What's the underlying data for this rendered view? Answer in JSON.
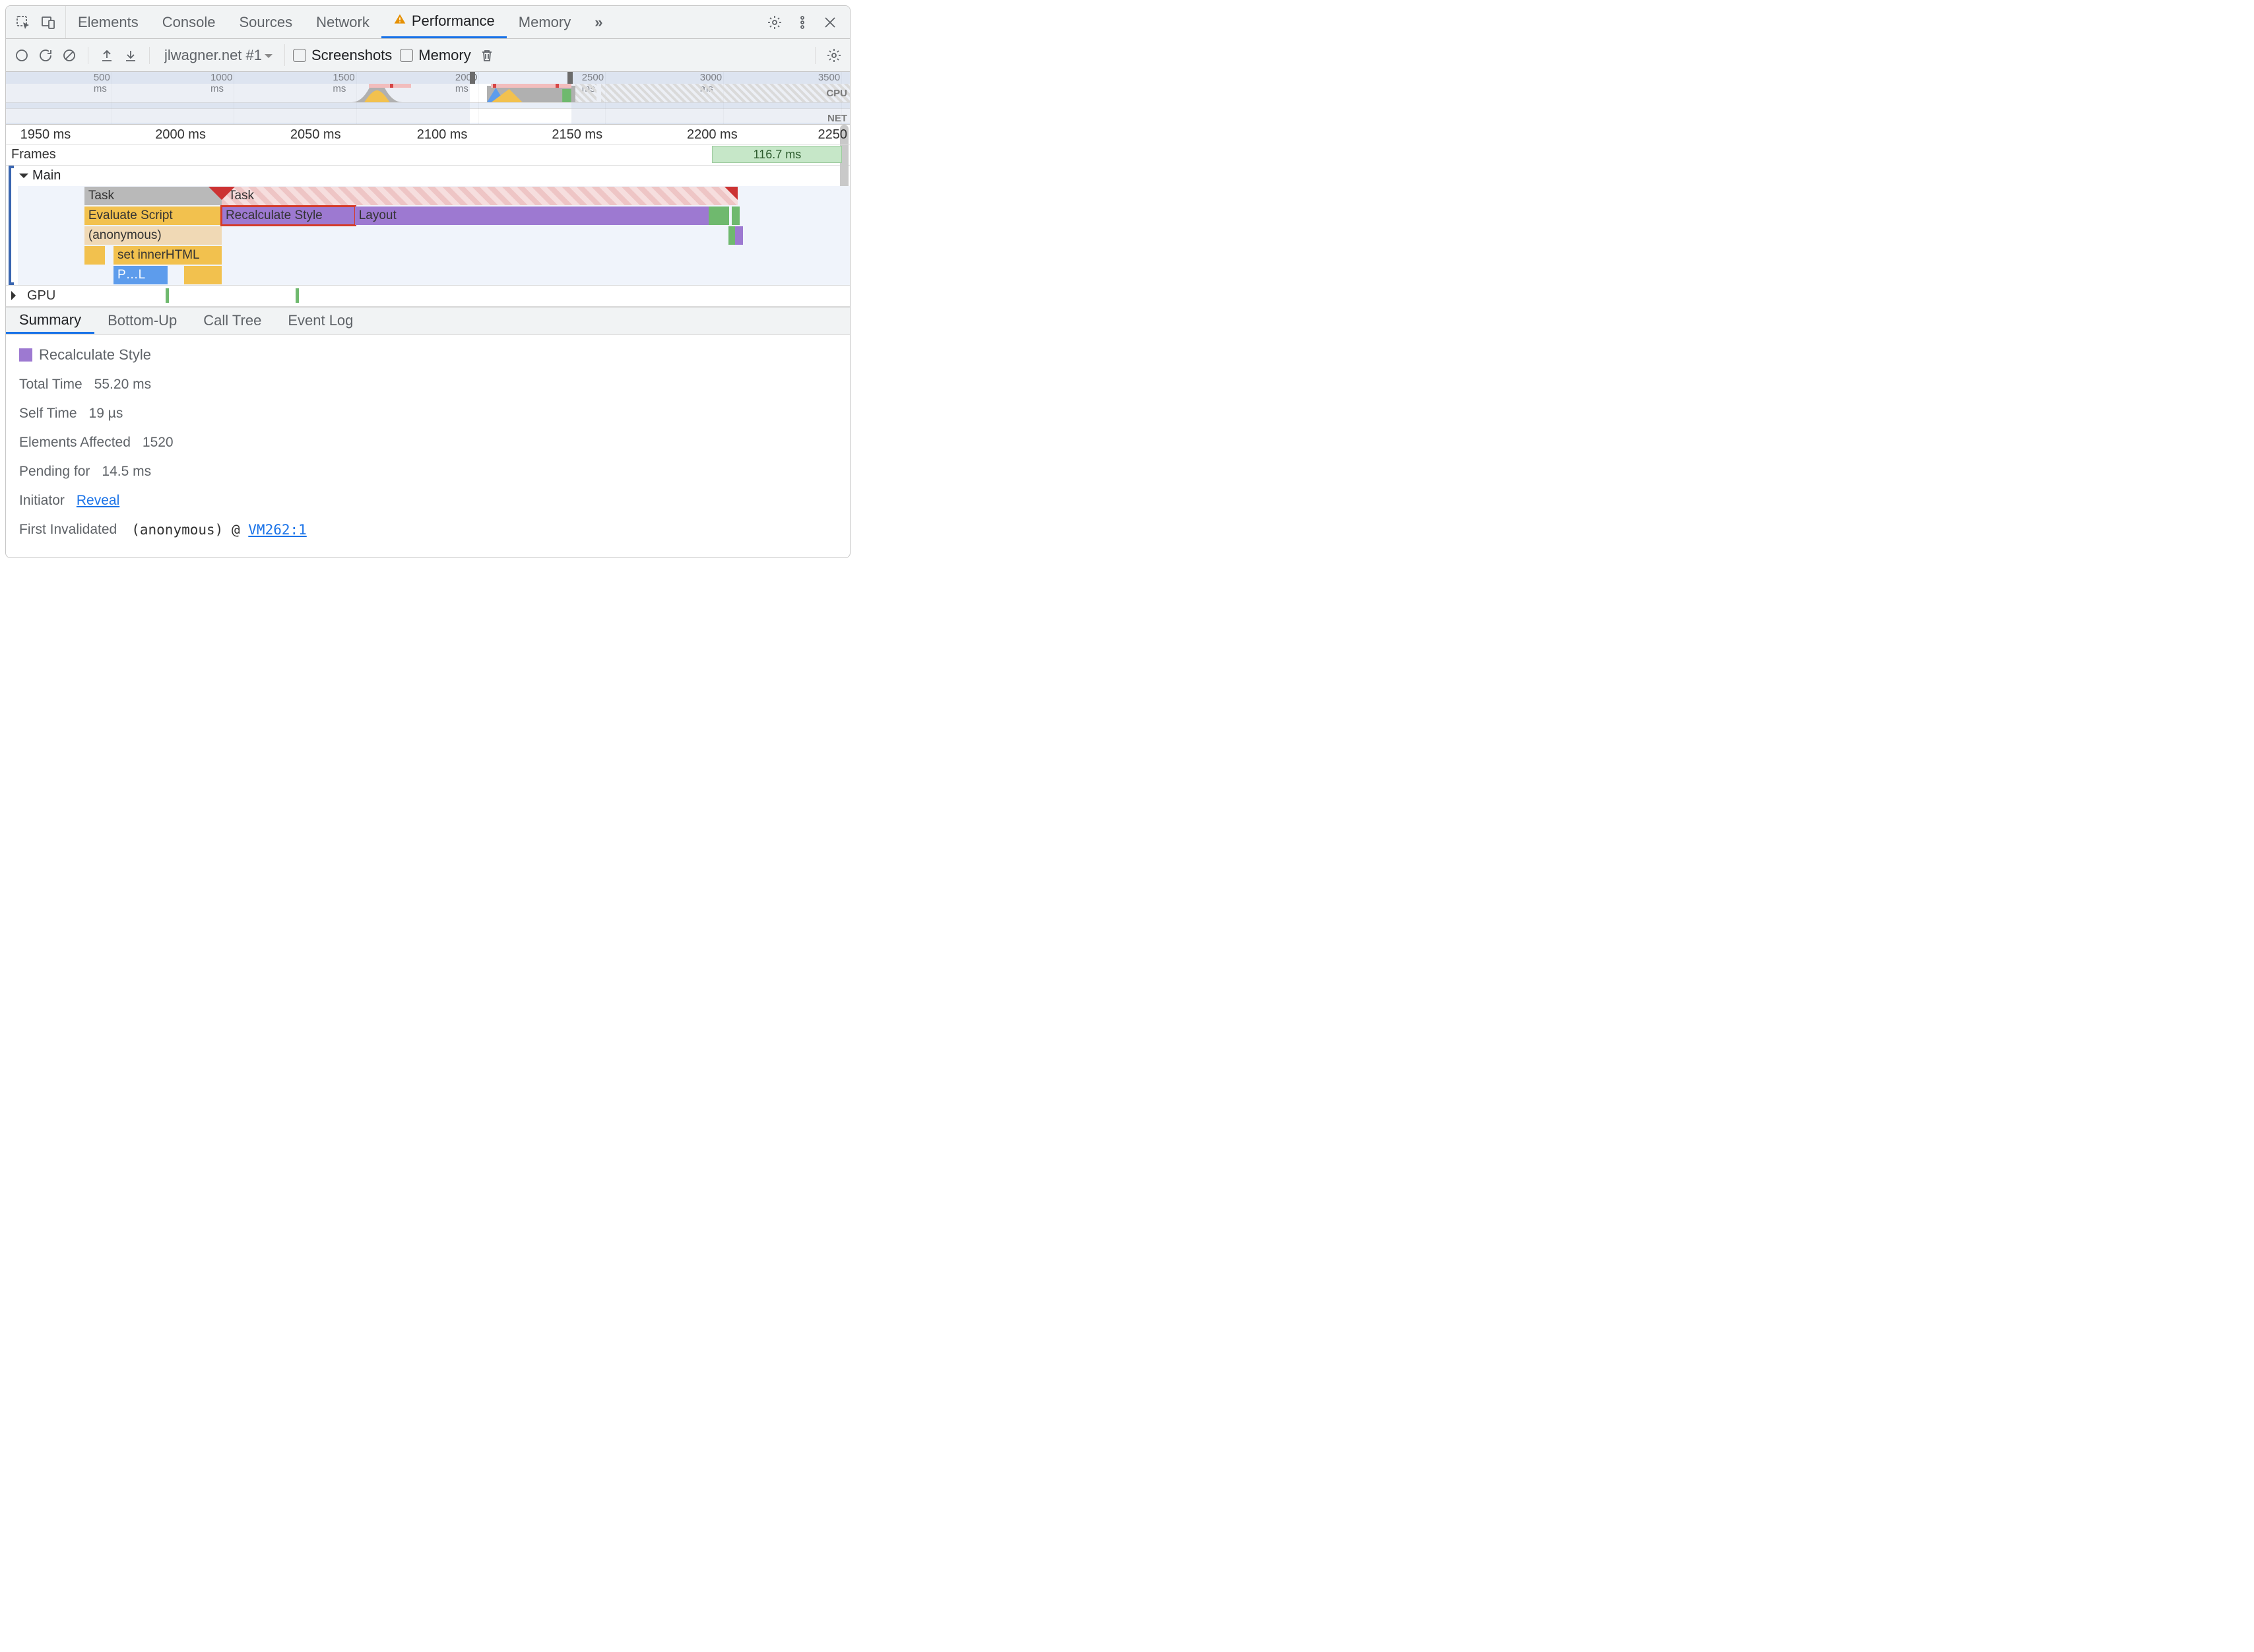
{
  "topTabs": {
    "items": [
      "Elements",
      "Console",
      "Sources",
      "Network",
      "Performance",
      "Memory"
    ],
    "activeIndex": 4,
    "hasWarnIcon": true,
    "overflow": "»"
  },
  "toolbar": {
    "recordingSelectValue": "jlwagner.net #1",
    "screenshotsLabel": "Screenshots",
    "memoryLabel": "Memory"
  },
  "overview": {
    "ticks": [
      "500 ms",
      "1000 ms",
      "1500 ms",
      "2000 ms",
      "2500 ms",
      "3000 ms",
      "3500"
    ],
    "cpuLabel": "CPU",
    "netLabel": "NET"
  },
  "ruler": [
    "1950 ms",
    "2000 ms",
    "2050 ms",
    "2100 ms",
    "2150 ms",
    "2200 ms",
    "2250 ms"
  ],
  "rows": {
    "frames": "Frames",
    "main": "Main",
    "gpu": "GPU"
  },
  "frameBlock": "116.7 ms",
  "flame": {
    "task": "Task",
    "taskLong": "Task",
    "evaluate": "Evaluate Script",
    "recalc": "Recalculate Style",
    "layout": "Layout",
    "anon": "(anonymous)",
    "setInner": "set innerHTML",
    "pl": "P…L"
  },
  "bottomTabs": {
    "items": [
      "Summary",
      "Bottom-Up",
      "Call Tree",
      "Event Log"
    ],
    "activeIndex": 0
  },
  "summary": {
    "title": "Recalculate Style",
    "rows": [
      {
        "k": "Total Time",
        "v": "55.20 ms"
      },
      {
        "k": "Self Time",
        "v": "19 µs"
      },
      {
        "k": "Elements Affected",
        "v": "1520"
      },
      {
        "k": "Pending for",
        "v": "14.5 ms"
      }
    ],
    "initiatorLabel": "Initiator",
    "reveal": "Reveal",
    "firstInvLabel": "First Invalidated",
    "firstInvFn": "(anonymous)",
    "at": "@",
    "firstInvLoc": "VM262:1"
  }
}
